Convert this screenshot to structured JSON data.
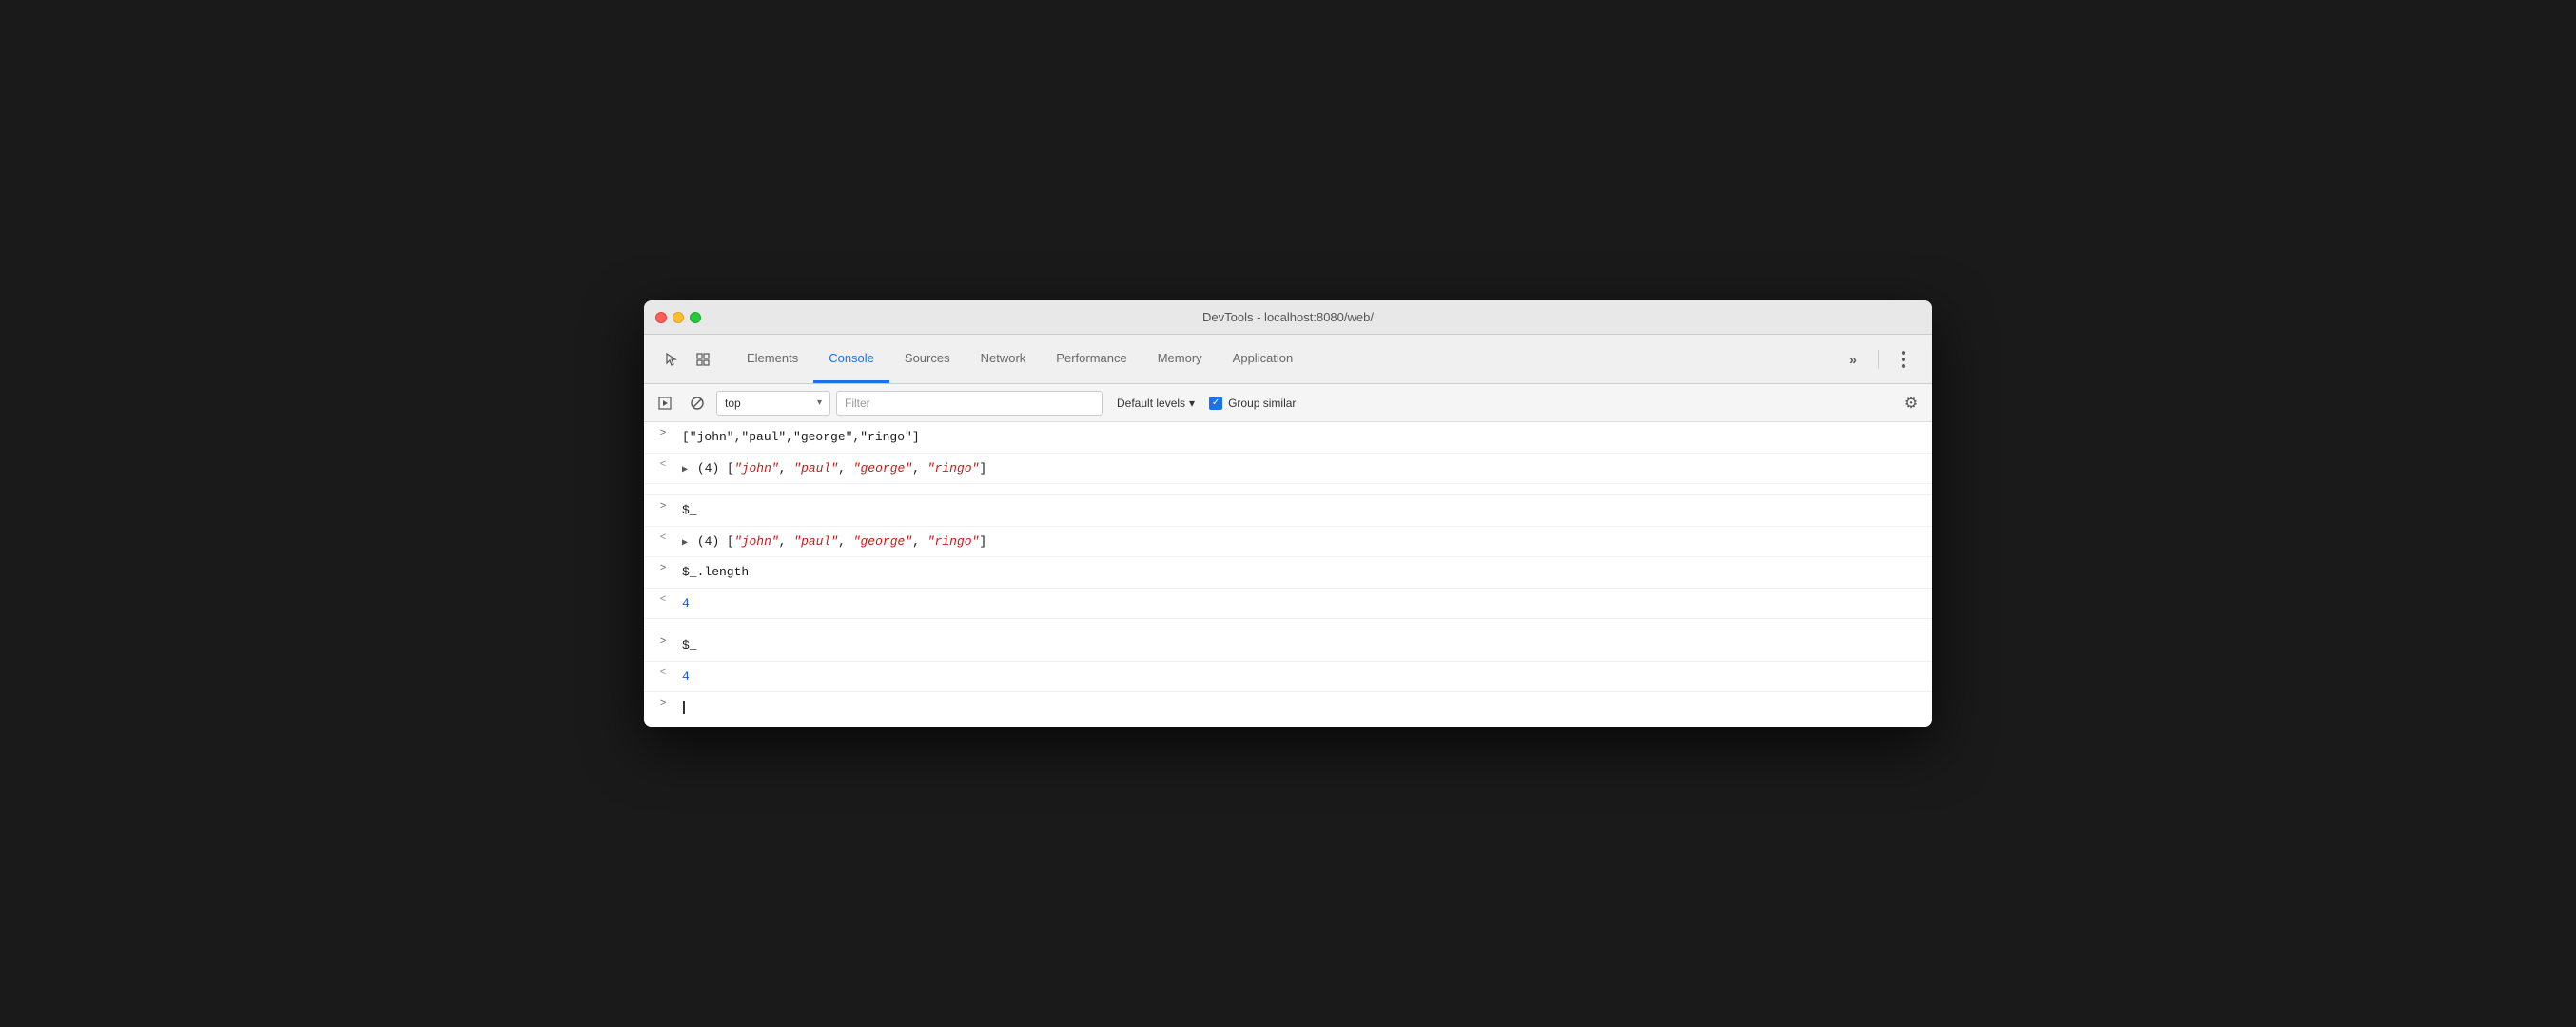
{
  "window": {
    "title": "DevTools - localhost:8080/web/"
  },
  "tabs": [
    {
      "id": "elements",
      "label": "Elements",
      "active": false
    },
    {
      "id": "console",
      "label": "Console",
      "active": true
    },
    {
      "id": "sources",
      "label": "Sources",
      "active": false
    },
    {
      "id": "network",
      "label": "Network",
      "active": false
    },
    {
      "id": "performance",
      "label": "Performance",
      "active": false
    },
    {
      "id": "memory",
      "label": "Memory",
      "active": false
    },
    {
      "id": "application",
      "label": "Application",
      "active": false
    }
  ],
  "toolbar": {
    "context": "top",
    "filter_placeholder": "Filter",
    "levels_label": "Default levels",
    "group_similar_label": "Group similar"
  },
  "console_rows": [
    {
      "type": "input",
      "content_html": "<span class='code-black'>[\"john\",\"paul\",\"george\",\"ringo\"]</span>"
    },
    {
      "type": "output_expandable",
      "content_html": "<span class='expand-arrow'>▶</span><span class='code-black'>(4) [</span><span class='code-red'>\"john\"</span><span class='code-black'>, </span><span class='code-red'>\"paul\"</span><span class='code-black'>, </span><span class='code-red'>\"george\"</span><span class='code-black'>, </span><span class='code-red'>\"ringo\"</span><span class='code-black'>]</span>"
    },
    {
      "type": "spacer"
    },
    {
      "type": "input",
      "content_html": "<span class='code-black'>$_</span>"
    },
    {
      "type": "output_expandable",
      "content_html": "<span class='expand-arrow'>▶</span><span class='code-black'>(4) [</span><span class='code-red'>\"john\"</span><span class='code-black'>, </span><span class='code-red'>\"paul\"</span><span class='code-black'>, </span><span class='code-red'>\"george\"</span><span class='code-black'>, </span><span class='code-red'>\"ringo\"</span><span class='code-black'>]</span>"
    },
    {
      "type": "input",
      "content_html": "<span class='code-black'>$_.length</span>"
    },
    {
      "type": "output",
      "content_html": "<span class='code-blue'>4</span>"
    },
    {
      "type": "spacer"
    },
    {
      "type": "input",
      "content_html": "<span class='code-black'>$_</span>"
    },
    {
      "type": "output",
      "content_html": "<span class='code-blue'>4</span>"
    },
    {
      "type": "cursor_input"
    }
  ],
  "icons": {
    "cursor": "↖",
    "layers": "⊞",
    "play": "▶",
    "ban": "⊘",
    "chevron_down": "▾",
    "more": "⋮",
    "gear": "⚙"
  }
}
